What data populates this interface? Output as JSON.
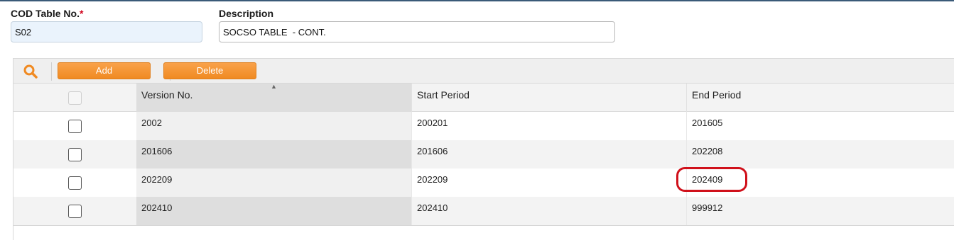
{
  "form": {
    "cod_label": "COD Table No.",
    "required_mark": "*",
    "cod_value": "S02",
    "desc_label": "Description",
    "desc_value": "SOCSO TABLE  - CONT."
  },
  "toolbar": {
    "search_icon": "search-icon",
    "add_label": "Add",
    "delete_label": "Delete"
  },
  "colors": {
    "button_orange": "#f08a22",
    "highlight_red": "#d0111b",
    "input_blue": "#eaf3fc"
  },
  "table": {
    "columns": [
      "Version No.",
      "Start Period",
      "End Period"
    ],
    "sort_column": "Version No.",
    "rows": [
      {
        "version": "2002",
        "start": "200201",
        "end": "201605"
      },
      {
        "version": "201606",
        "start": "201606",
        "end": "202208"
      },
      {
        "version": "202209",
        "start": "202209",
        "end": "202409"
      },
      {
        "version": "202410",
        "start": "202410",
        "end": "999912"
      }
    ],
    "highlighted_cell": {
      "row": 2,
      "column": "End Period"
    }
  }
}
